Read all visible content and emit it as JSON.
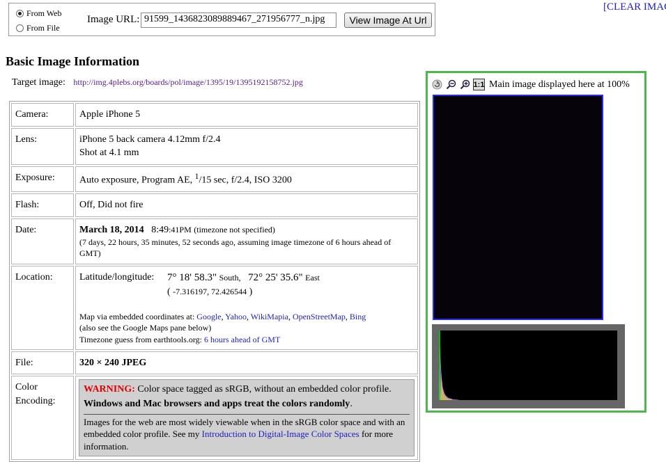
{
  "url_form": {
    "radio_web_label": "From Web",
    "radio_file_label": "From File",
    "selected_source": "web",
    "url_label": "Image URL:",
    "url_value": "91599_1436823089889467_271956777_n.jpg",
    "submit_label": "View Image At Url"
  },
  "clear_link": "[CLEAR IMAG",
  "section_heading": "Basic Image Information",
  "target": {
    "label": "Target image:",
    "url": "http://img.4plebs.org/boards/pol/image/1395/19/1395192158752.jpg"
  },
  "camera": {
    "label": "Camera:",
    "value": "Apple iPhone 5"
  },
  "lens": {
    "label": "Lens:",
    "value": "iPhone 5 back camera 4.12mm f/2.4",
    "shot": "Shot at 4.1 mm"
  },
  "exposure": {
    "label": "Exposure:",
    "prefix": "Auto exposure, Program AE,",
    "numerator": "1",
    "denominator": "15 sec, f/2.4, ISO 3200"
  },
  "flash": {
    "label": "Flash:",
    "value": "Off, Did not fire"
  },
  "date": {
    "label": "Date:",
    "day": "March 18, 2014",
    "time_main": "8:49",
    "time_rest": ":41PM",
    "tz_note": "(timezone not specified)",
    "ago": "(7 days, 22 hours, 35 minutes, 52 seconds ago, assuming image timezone of 6 hours ahead of GMT)"
  },
  "location": {
    "label": "Location:",
    "latlon_label": "Latitude/longitude:",
    "lat_deg": "7° 18' 58.3\"",
    "lat_dir": "South,",
    "lon_deg": "72° 25' 35.6\"",
    "lon_dir": "East",
    "decimal": "-7.316197, 72.426544",
    "map_intro": "Map via embedded coordinates at:",
    "map_links": [
      "Google",
      "Yahoo",
      "WikiMapia",
      "OpenStreetMap",
      "Bing"
    ],
    "maps_note": "(also see the Google Maps pane below)",
    "tz_intro": "Timezone guess from earthtools.org:",
    "tz_link": "6 hours ahead of GMT"
  },
  "file": {
    "label": "File:",
    "value": "320 × 240 JPEG"
  },
  "color": {
    "label": "Color Encoding:",
    "warning_label": "WARNING:",
    "warning_text": "Color space tagged as sRGB, without an embedded color profile.",
    "warning_bold": "Windows and Mac browsers and apps treat the colors randomly",
    "warning_end": ".",
    "info_text": "Images for the web are most widely viewable when in the sRGB color space and with an embedded color profile. See my",
    "info_link": "Introduction to Digital-Image Color Spaces",
    "info_end": "for more information."
  },
  "image_panel": {
    "caption": "Main image displayed here at 100%",
    "one_to_one_label": "1:1",
    "border_color": "#4cb84c",
    "image_border_color": "#2a2af0"
  },
  "icons": {
    "reset": "rotate-icon",
    "zoom_out": "zoom-out-icon",
    "zoom_in": "zoom-in-icon",
    "actual_size": "actual-size-icon"
  }
}
